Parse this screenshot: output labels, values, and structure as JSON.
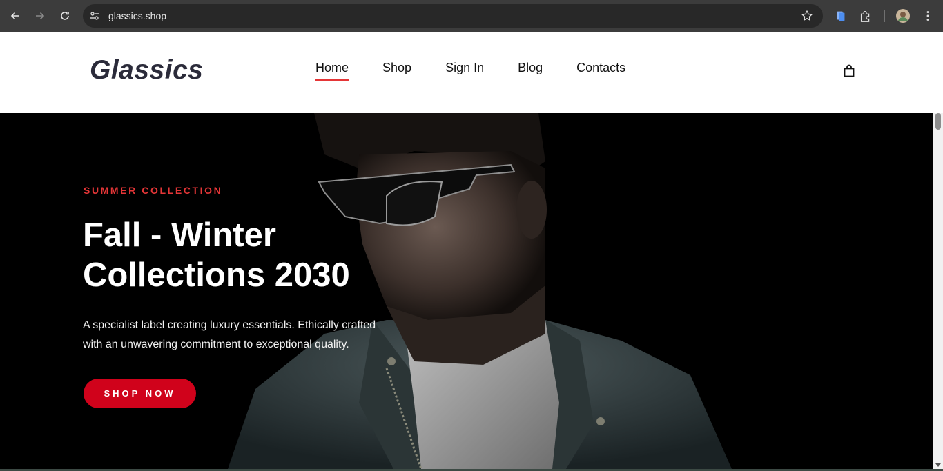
{
  "browser": {
    "url": "glassics.shop",
    "icons": [
      "back-arrow-icon",
      "forward-arrow-icon",
      "reload-icon",
      "site-settings-icon",
      "bookmark-star-icon",
      "extension-docs-icon",
      "extensions-puzzle-icon",
      "profile-avatar-icon",
      "more-vert-icon"
    ]
  },
  "header": {
    "logo": "Glassics",
    "nav": [
      {
        "label": "Home",
        "active": true
      },
      {
        "label": "Shop"
      },
      {
        "label": "Sign In"
      },
      {
        "label": "Blog"
      },
      {
        "label": "Contacts"
      }
    ],
    "cart_icon": "shopping-bag-icon"
  },
  "hero": {
    "eyebrow": "SUMMER COLLECTION",
    "title": "Fall - Winter Collections 2030",
    "description": "A specialist label creating luxury essentials. Ethically crafted with an unwavering commitment to exceptional quality.",
    "cta": "SHOP NOW"
  },
  "colors": {
    "accent": "#e53637",
    "cta": "#d0021b",
    "hero_bg": "#000000",
    "chrome_bg": "#3c3c3c"
  }
}
